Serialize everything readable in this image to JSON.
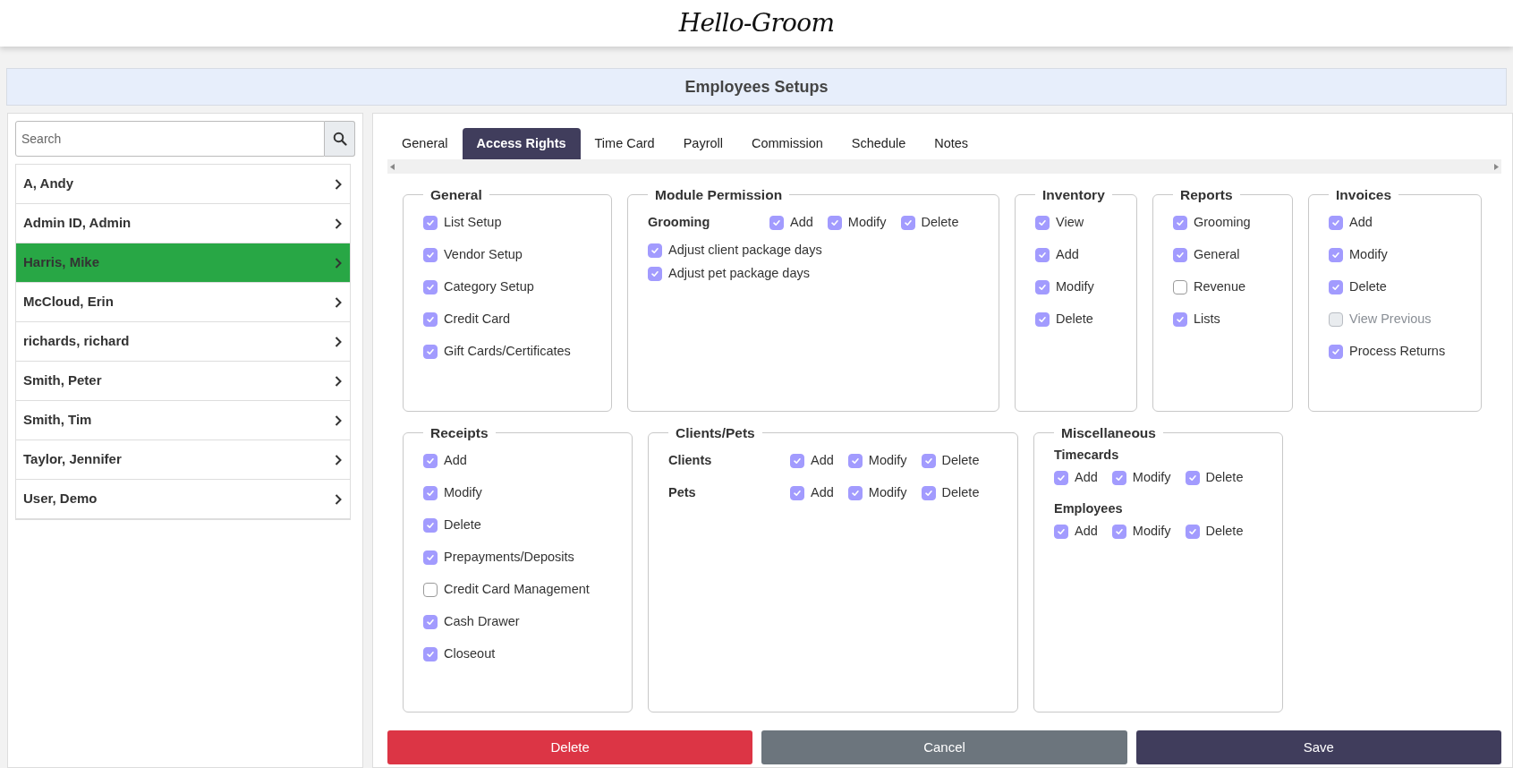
{
  "header": {
    "logo": "Hello-Groom"
  },
  "page_title": "Employees Setups",
  "search": {
    "placeholder": "Search"
  },
  "employees": [
    {
      "name": "A, Andy",
      "selected": false
    },
    {
      "name": "Admin ID, Admin",
      "selected": false
    },
    {
      "name": "Harris, Mike",
      "selected": true
    },
    {
      "name": "McCloud, Erin",
      "selected": false
    },
    {
      "name": "richards, richard",
      "selected": false
    },
    {
      "name": "Smith, Peter",
      "selected": false
    },
    {
      "name": "Smith, Tim",
      "selected": false
    },
    {
      "name": "Taylor, Jennifer",
      "selected": false
    },
    {
      "name": "User, Demo",
      "selected": false
    }
  ],
  "tabs": [
    {
      "label": "General",
      "selected": false
    },
    {
      "label": "Access Rights",
      "selected": true
    },
    {
      "label": "Time Card",
      "selected": false
    },
    {
      "label": "Payroll",
      "selected": false
    },
    {
      "label": "Commission",
      "selected": false
    },
    {
      "label": "Schedule",
      "selected": false
    },
    {
      "label": "Notes",
      "selected": false
    }
  ],
  "group_rows": [
    [
      {
        "title": "General",
        "items": [
          {
            "kind": "check",
            "label": "List Setup",
            "checked": true,
            "disabled": false
          },
          {
            "kind": "check",
            "label": "Vendor Setup",
            "checked": true,
            "disabled": false
          },
          {
            "kind": "check",
            "label": "Category Setup",
            "checked": true,
            "disabled": false
          },
          {
            "kind": "check",
            "label": "Credit Card",
            "checked": true,
            "disabled": false
          },
          {
            "kind": "check",
            "label": "Gift Cards/Certificates",
            "checked": true,
            "disabled": false
          }
        ]
      },
      {
        "title": "Module Permission",
        "items": [
          {
            "kind": "row",
            "label": "Grooming",
            "options": [
              {
                "label": "Add",
                "checked": true
              },
              {
                "label": "Modify",
                "checked": true
              },
              {
                "label": "Delete",
                "checked": true
              }
            ]
          },
          {
            "kind": "compact",
            "label": "Adjust client package days",
            "checked": true,
            "disabled": false
          },
          {
            "kind": "compact",
            "label": "Adjust pet package days",
            "checked": true,
            "disabled": false
          }
        ]
      },
      {
        "title": "Inventory",
        "items": [
          {
            "kind": "check",
            "label": "View",
            "checked": true,
            "disabled": false
          },
          {
            "kind": "check",
            "label": "Add",
            "checked": true,
            "disabled": false
          },
          {
            "kind": "check",
            "label": "Modify",
            "checked": true,
            "disabled": false
          },
          {
            "kind": "check",
            "label": "Delete",
            "checked": true,
            "disabled": false
          }
        ]
      },
      {
        "title": "Reports",
        "items": [
          {
            "kind": "check",
            "label": "Grooming",
            "checked": true,
            "disabled": false
          },
          {
            "kind": "check",
            "label": "General",
            "checked": true,
            "disabled": false
          },
          {
            "kind": "check",
            "label": "Revenue",
            "checked": false,
            "disabled": false
          },
          {
            "kind": "check",
            "label": "Lists",
            "checked": true,
            "disabled": false
          }
        ]
      },
      {
        "title": "Invoices",
        "items": [
          {
            "kind": "check",
            "label": "Add",
            "checked": true,
            "disabled": false
          },
          {
            "kind": "check",
            "label": "Modify",
            "checked": true,
            "disabled": false
          },
          {
            "kind": "check",
            "label": "Delete",
            "checked": true,
            "disabled": false
          },
          {
            "kind": "check",
            "label": "View Previous",
            "checked": false,
            "disabled": true
          },
          {
            "kind": "check",
            "label": "Process Returns",
            "checked": true,
            "disabled": false
          }
        ]
      }
    ],
    [
      {
        "title": "Receipts",
        "items": [
          {
            "kind": "check",
            "label": "Add",
            "checked": true,
            "disabled": false
          },
          {
            "kind": "check",
            "label": "Modify",
            "checked": true,
            "disabled": false
          },
          {
            "kind": "check",
            "label": "Delete",
            "checked": true,
            "disabled": false
          },
          {
            "kind": "check",
            "label": "Prepayments/Deposits",
            "checked": true,
            "disabled": false
          },
          {
            "kind": "check",
            "label": "Credit Card Management",
            "checked": false,
            "disabled": false
          },
          {
            "kind": "check",
            "label": "Cash Drawer",
            "checked": true,
            "disabled": false
          },
          {
            "kind": "check",
            "label": "Closeout",
            "checked": true,
            "disabled": false
          }
        ]
      },
      {
        "title": "Clients/Pets",
        "items": [
          {
            "kind": "row",
            "label": "Clients",
            "options": [
              {
                "label": "Add",
                "checked": true
              },
              {
                "label": "Modify",
                "checked": true
              },
              {
                "label": "Delete",
                "checked": true
              }
            ]
          },
          {
            "kind": "row",
            "label": "Pets",
            "options": [
              {
                "label": "Add",
                "checked": true
              },
              {
                "label": "Modify",
                "checked": true
              },
              {
                "label": "Delete",
                "checked": true
              }
            ]
          }
        ]
      },
      {
        "title": "Miscellaneous",
        "items": [
          {
            "kind": "stack",
            "label": "Timecards",
            "options": [
              {
                "label": "Add",
                "checked": true
              },
              {
                "label": "Modify",
                "checked": true
              },
              {
                "label": "Delete",
                "checked": true
              }
            ]
          },
          {
            "kind": "stack",
            "label": "Employees",
            "options": [
              {
                "label": "Add",
                "checked": true
              },
              {
                "label": "Modify",
                "checked": true
              },
              {
                "label": "Delete",
                "checked": true
              }
            ]
          }
        ]
      }
    ]
  ],
  "buttons": [
    {
      "label": "Delete",
      "kind": "danger"
    },
    {
      "label": "Cancel",
      "kind": "secondary"
    },
    {
      "label": "Save",
      "kind": "primary"
    }
  ]
}
